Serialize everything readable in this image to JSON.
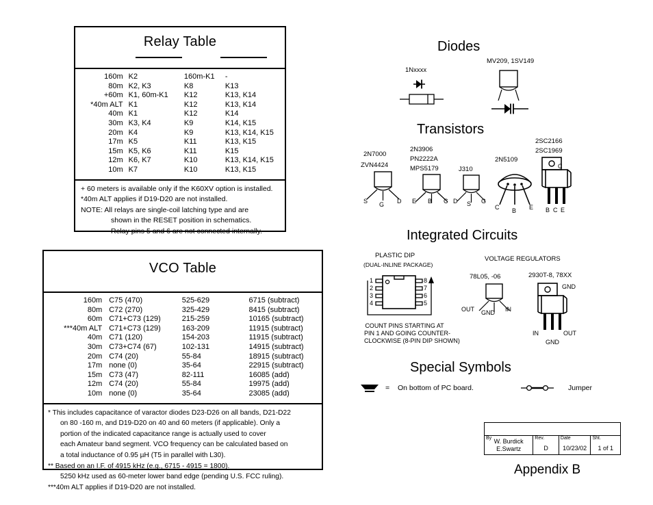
{
  "relay_table": {
    "title": "Relay Table",
    "rows": [
      [
        "160m",
        "K2",
        "160m-K1",
        "-"
      ],
      [
        "80m",
        "K2, K3",
        "K8",
        "K13"
      ],
      [
        "+60m",
        "K1, 60m-K1",
        "K12",
        "K13, K14"
      ],
      [
        "*40m ALT",
        "K1",
        "K12",
        "K13, K14"
      ],
      [
        "40m",
        "K1",
        "K12",
        "K14"
      ],
      [
        "30m",
        "K3, K4",
        "K9",
        "K14, K15"
      ],
      [
        "20m",
        "K4",
        "K9",
        "K13, K14, K15"
      ],
      [
        "17m",
        "K5",
        "K11",
        "K13, K15"
      ],
      [
        "15m",
        "K5, K6",
        "K11",
        "K15"
      ],
      [
        "12m",
        "K6, K7",
        "K10",
        "K13, K14, K15"
      ],
      [
        "10m",
        "K7",
        "K10",
        "K13, K15"
      ]
    ],
    "notes": [
      {
        "text": "+ 60 meters is available only if the K60XV option is installed.",
        "indent": false
      },
      {
        "text": "*40m ALT applies if D19-D20 are not installed.",
        "indent": false
      },
      {
        "text": "NOTE:  All relays are single-coil latching type and are",
        "indent": false
      },
      {
        "text": "shown in the RESET position in schematics.",
        "indent": true
      },
      {
        "text": "Relay pins 5 and 6 are not connected internally.",
        "indent": true
      }
    ]
  },
  "vco_table": {
    "title": "VCO Table",
    "rows": [
      [
        "160m",
        "C75 (470)",
        "525-629",
        "6715 (subtract)"
      ],
      [
        "80m",
        "C72 (270)",
        "325-429",
        "8415 (subtract)"
      ],
      [
        "60m",
        "C71+C73 (129)",
        "215-259",
        "10165 (subtract)"
      ],
      [
        "***40m ALT",
        "C71+C73 (129)",
        "163-209",
        "11915 (subtract)"
      ],
      [
        "40m",
        "C71 (120)",
        "154-203",
        "11915 (subtract)"
      ],
      [
        "30m",
        "C73+C74 (67)",
        "102-131",
        "14915 (subtract)"
      ],
      [
        "20m",
        "C74 (20)",
        "55-84",
        "18915 (subtract)"
      ],
      [
        "17m",
        "none (0)",
        "35-64",
        "22915 (subtract)"
      ],
      [
        "15m",
        "C73 (47)",
        "82-111",
        "16085 (add)"
      ],
      [
        "12m",
        "C74 (20)",
        "55-84",
        "19975 (add)"
      ],
      [
        "10m",
        "none (0)",
        "35-64",
        "23085 (add)"
      ]
    ],
    "notes": [
      {
        "text": "* This includes capacitance of varactor diodes D23-D26 on all bands, D21-D22",
        "indent": false
      },
      {
        "text": "on 80 -160 m, and D19-D20 on 40 and 60 meters (if applicable). Only a",
        "indent": true
      },
      {
        "text": "portion of the indicated capacitance range is actually used to cover",
        "indent": true
      },
      {
        "text": "each Amateur band segment. VCO frequency can be calculated based on",
        "indent": true
      },
      {
        "text": "a total inductance of 0.95 µH (T5 in parallel with L30).",
        "indent": true
      },
      {
        "text": "** Based on an I.F. of 4915 kHz (e.g., 6715 - 4915 = 1800).",
        "indent": false
      },
      {
        "text": "5250 kHz used as 60-meter lower band edge (pending U.S. FCC ruling).",
        "indent": true
      },
      {
        "text": "***40m ALT applies if D19-D20 are not installed.",
        "indent": false
      }
    ]
  },
  "diodes": {
    "heading": "Diodes",
    "parts": [
      {
        "label": "1Nxxxx"
      },
      {
        "label": "MV209, 1SV149"
      }
    ]
  },
  "transistors": {
    "heading": "Transistors",
    "parts": [
      {
        "labels": [
          "2N7000",
          "ZVN4424"
        ],
        "pins": [
          "S",
          "G",
          "D"
        ]
      },
      {
        "labels": [
          "2N3906",
          "PN2222A",
          "MPS5179"
        ],
        "pins": [
          "E",
          "B",
          "C"
        ]
      },
      {
        "labels": [
          "J310"
        ],
        "pins": [
          "D",
          "S",
          "G"
        ]
      },
      {
        "labels": [
          "2N5109"
        ],
        "pins": [
          "C",
          "B",
          "E"
        ]
      },
      {
        "labels": [
          "2SC2166",
          "2SC1969"
        ],
        "pins": [
          "B",
          "C",
          "E"
        ],
        "tab_pin": "C"
      }
    ]
  },
  "integrated_circuits": {
    "heading": "Integrated Circuits",
    "dip": {
      "title": "PLASTIC DIP",
      "subtitle": "(DUAL-INLINE PACKAGE)",
      "pins_left": [
        "1",
        "2",
        "3",
        "4"
      ],
      "pins_right": [
        "8",
        "7",
        "6",
        "5"
      ],
      "caption": [
        "COUNT PINS STARTING AT",
        "PIN 1 AND GOING COUNTER-",
        "CLOCKWISE (8-PIN DIP SHOWN)"
      ]
    },
    "regulators": {
      "title": "VOLTAGE REGULATORS",
      "to92": {
        "label": "78L05, -06",
        "pins": [
          "OUT",
          "GND",
          "IN"
        ]
      },
      "to220": {
        "label": "2930T-8, 78XX",
        "tab_pin": "GND",
        "pins": [
          "IN",
          "GND",
          "OUT"
        ]
      }
    }
  },
  "special_symbols": {
    "heading": "Special Symbols",
    "items": [
      {
        "equals": "=",
        "text": "On bottom of PC board."
      },
      {
        "text": "Jumper"
      }
    ]
  },
  "title_block": {
    "by_key": "By",
    "by_value": "W. Burdick\nE.Swartz",
    "by_line1": "W. Burdick",
    "by_line2": "E.Swartz",
    "rev_key": "Rev.",
    "rev_value": "D",
    "date_key": "Date",
    "date_value": "10/23/02",
    "sht_key": "Sht.",
    "sht_value": "1 of 1"
  },
  "appendix": "Appendix B"
}
